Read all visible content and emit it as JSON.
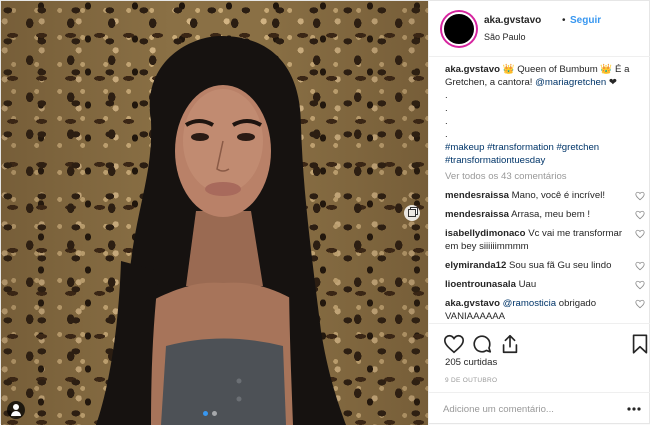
{
  "header": {
    "username": "aka.gvstavo",
    "separator": "•",
    "follow_label": "Seguir",
    "location": "São Paulo"
  },
  "caption": {
    "username": "aka.gvstavo",
    "text_part1": "👑 Queen of Bumbum 👑 É a Gretchen, a cantora!",
    "mention": "@mariagretchen",
    "text_part2": "❤",
    "dots": [
      ".",
      ".",
      ".",
      "."
    ],
    "hashtags": "#makeup #transformation #gretchen #transformationtuesday"
  },
  "view_all_comments": "Ver todos os 43 comentários",
  "comments": [
    {
      "user": "mendesraissa",
      "text": "Mano, você é incrível!"
    },
    {
      "user": "mendesraissa",
      "text": "Arrasa, meu bem !"
    },
    {
      "user": "isabellydimonaco",
      "text": "Vc vai me transformar em bey siiiiiimmmm"
    },
    {
      "user": "elymiranda12",
      "text": "Sou sua fã Gu seu lindo"
    },
    {
      "user": "lioentrounasala",
      "text": "Uau"
    }
  ],
  "reply": {
    "user": "aka.gvstavo",
    "mention": "@ramosticia",
    "text": "obrigado VANIAAAAAA"
  },
  "likes": "205 curtidas",
  "date": "9 DE OUTUBRO",
  "add_comment_placeholder": "Adicione um comentário...",
  "icons": {
    "like": "heart-icon",
    "comment": "comment-icon",
    "share": "share-icon",
    "save": "bookmark-icon",
    "more": "more-options-icon",
    "carousel": "carousel-icon",
    "user_tag": "user-tag-icon"
  },
  "colors": {
    "link_blue": "#3897f0",
    "hashtag_blue": "#003569",
    "muted": "#999999",
    "text": "#262626"
  }
}
